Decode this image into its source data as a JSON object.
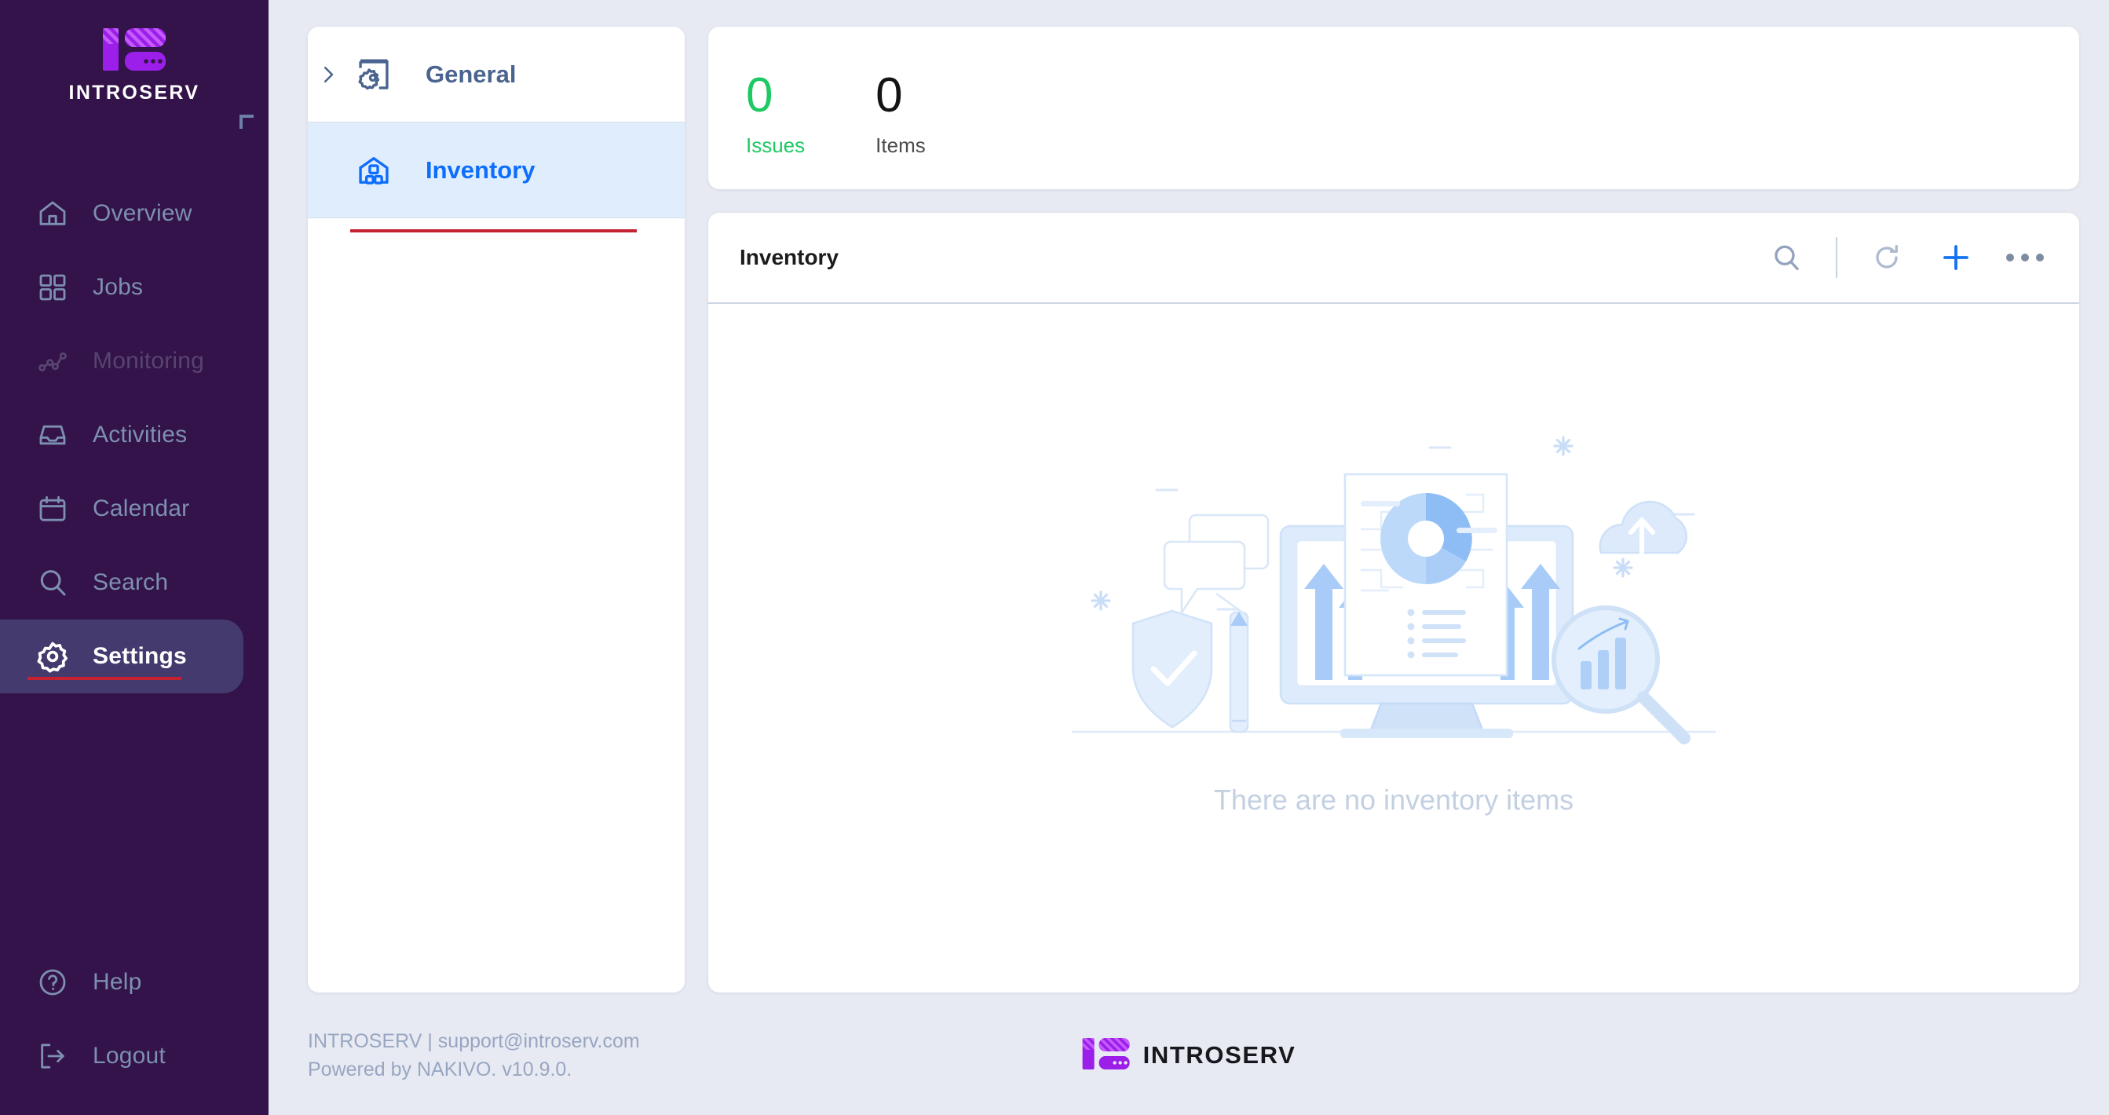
{
  "brand": {
    "name": "INTROSERV",
    "logo_icon": "introserv-server-logo"
  },
  "sidebar": {
    "items": [
      {
        "label": "Overview",
        "icon": "home-icon",
        "state": "normal"
      },
      {
        "label": "Jobs",
        "icon": "grid-icon",
        "state": "normal"
      },
      {
        "label": "Monitoring",
        "icon": "line-chart-icon",
        "state": "disabled"
      },
      {
        "label": "Activities",
        "icon": "inbox-icon",
        "state": "normal"
      },
      {
        "label": "Calendar",
        "icon": "calendar-icon",
        "state": "normal"
      },
      {
        "label": "Search",
        "icon": "search-icon",
        "state": "normal"
      },
      {
        "label": "Settings",
        "icon": "gear-icon",
        "state": "active"
      }
    ],
    "bottom_items": [
      {
        "label": "Help",
        "icon": "question-circle-icon"
      },
      {
        "label": "Logout",
        "icon": "logout-arrow-icon"
      }
    ],
    "collapse_handle_icon": "corner-bracket-icon"
  },
  "settings_menu": {
    "items": [
      {
        "label": "General",
        "icon": "window-gear-icon",
        "expandable": true,
        "state": "normal",
        "chevron_icon": "chevron-right-icon"
      },
      {
        "label": "Inventory",
        "icon": "warehouse-blocks-icon",
        "expandable": false,
        "state": "active"
      }
    ]
  },
  "stats": {
    "issues": {
      "value": "0",
      "label": "Issues"
    },
    "items": {
      "value": "0",
      "label": "Items"
    }
  },
  "panel": {
    "title": "Inventory",
    "tools": [
      {
        "name": "search-icon",
        "label": "Search"
      },
      {
        "name": "refresh-icon",
        "label": "Refresh"
      },
      {
        "name": "plus-icon",
        "label": "Add"
      },
      {
        "name": "more-icon",
        "label": "More actions"
      }
    ],
    "empty_state": {
      "message": "There are no inventory items",
      "illustration": "empty-inventory-illustration"
    }
  },
  "footer": {
    "line1": "INTROSERV | support@introserv.com",
    "line2": "Powered by NAKIVO. v10.9.0.",
    "logo_word": "INTROSERV",
    "logo_icon": "introserv-server-logo"
  },
  "colors": {
    "sidebar_bg": "#33134a",
    "sidebar_active_bg": "#443a6e",
    "accent_red": "#c42131",
    "brand_purple": "#9b1fe8",
    "page_bg": "#e7eaf2",
    "link_blue": "#0d6efd",
    "success_green": "#1ec964",
    "muted_text": "#7d8fb3"
  }
}
